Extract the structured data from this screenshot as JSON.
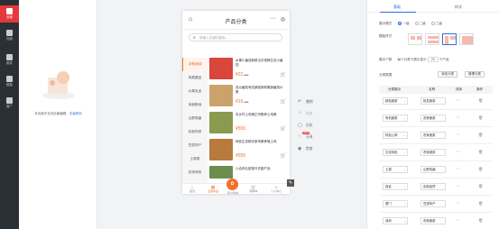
{
  "nav": [
    {
      "label": "页面",
      "active": true
    },
    {
      "label": "页面",
      "active": false
    },
    {
      "label": "组件",
      "active": false
    },
    {
      "label": "模板",
      "active": false
    },
    {
      "label": "推广",
      "active": false
    }
  ],
  "left_panel": {
    "tip_text": "本页面不支持页面编辑，",
    "tip_link": "去装修页"
  },
  "phone": {
    "title": "产品分类",
    "search_placeholder": "请输入关键词搜索...",
    "categories": [
      "新鲜蔬菜",
      "肉禽蛋品",
      "水果乳品",
      "米面粮油",
      "山野真菌",
      "乳制肉饼",
      "豆类特产",
      "土锅菜",
      "农场体验",
      "吃饭零食"
    ],
    "products": [
      {
        "name": "水果小番茄新鲜当天现摘生态小番茄",
        "price": "¥22",
        "old_price": "¥40",
        "img": "#d8463c"
      },
      {
        "name": "西瓜番茄有机蔬菜新鲜果蔬番茄炒蛋",
        "price": "¥19",
        "old_price": "¥25",
        "img": "#c9a36b"
      },
      {
        "name": "农乡村土鸡蛋正宗散养土鸡蛋",
        "price": "¥555",
        "old_price": "",
        "img": "#8a9a4f"
      },
      {
        "name": "绿色生态鲜农家鸡蛋养殖土鸡",
        "price": "¥555",
        "old_price": "",
        "img": "#b87a3d"
      },
      {
        "name": "六合林业甜菜叶农副产品",
        "price": "",
        "old_price": "",
        "img": "#6b8e4e"
      }
    ],
    "tabbar": [
      "首页",
      "全部商品",
      "积分商城",
      "购物车",
      "个人中心"
    ]
  },
  "tools": [
    {
      "label": "撤销",
      "icon": "undo-icon",
      "disabled": false
    },
    {
      "label": "恢复",
      "icon": "redo-icon",
      "disabled": true
    },
    {
      "label": "历史",
      "icon": "history-icon",
      "disabled": false
    },
    {
      "label": "分享",
      "icon": "share-icon",
      "disabled": false,
      "badge": "NEW"
    },
    {
      "label": "检查",
      "icon": "check-icon",
      "disabled": false
    }
  ],
  "right_panel": {
    "tabs": [
      "基础",
      "样式"
    ],
    "show_type_label": "展示模式",
    "show_type_options": [
      "一级",
      "二级",
      "三级"
    ],
    "template_label": "模板样式",
    "display_label": "展示个数",
    "display_text": "每个分类下展示显示",
    "display_count": "20",
    "display_unit": "个产品",
    "category_label": "分类数据",
    "add_button": "添加分类",
    "manage_button": "管理分类",
    "table_headers": [
      "分类展示",
      "名称",
      "排序",
      "操作"
    ],
    "rows": [
      {
        "category": "精品蔬菜",
        "name": "批发蔬菜"
      },
      {
        "category": "有机蔬菜",
        "name": "农家蔬菜"
      },
      {
        "category": "特色公寓",
        "name": "农家蔬菜"
      },
      {
        "category": "文化特色",
        "name": "农家蔬菜"
      },
      {
        "category": "土锅",
        "name": "山野真菌"
      },
      {
        "category": "西谷",
        "name": "乳制品饼"
      },
      {
        "category": "厦门",
        "name": "豆类特产"
      },
      {
        "category": "深圳",
        "name": "农家蔬菜"
      }
    ]
  }
}
